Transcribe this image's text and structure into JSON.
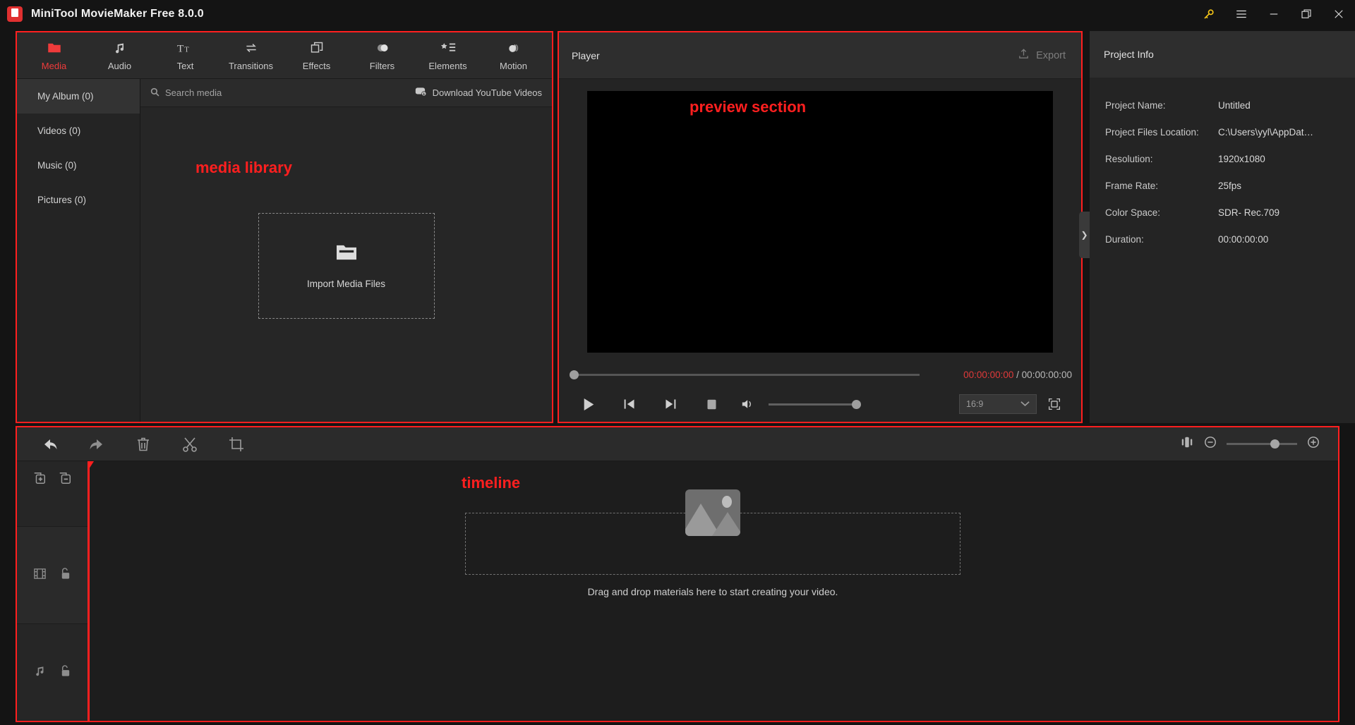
{
  "titlebar": {
    "app_title": "MiniTool MovieMaker Free 8.0.0",
    "logo_name": "minitool-logo",
    "buttons": [
      {
        "name": "key-icon",
        "label": "Activate",
        "color": "#f5c518"
      },
      {
        "name": "menu-icon",
        "label": "Menu"
      },
      {
        "name": "minimize-icon",
        "label": "Minimize"
      },
      {
        "name": "maximize-icon",
        "label": "Maximize"
      },
      {
        "name": "close-icon",
        "label": "Close"
      }
    ]
  },
  "nav_tabs": [
    {
      "label": "Media",
      "icon": "folder-icon",
      "active": true
    },
    {
      "label": "Audio",
      "icon": "music-note-icon",
      "active": false
    },
    {
      "label": "Text",
      "icon": "text-tt-icon",
      "active": false
    },
    {
      "label": "Transitions",
      "icon": "transitions-arrows-icon",
      "active": false
    },
    {
      "label": "Effects",
      "icon": "effects-squares-icon",
      "active": false
    },
    {
      "label": "Filters",
      "icon": "filters-circles-icon",
      "active": false
    },
    {
      "label": "Elements",
      "icon": "elements-star-list-icon",
      "active": false
    },
    {
      "label": "Motion",
      "icon": "motion-sphere-icon",
      "active": false
    }
  ],
  "library": {
    "categories": [
      {
        "label": "My Album (0)",
        "active": true
      },
      {
        "label": "Videos (0)",
        "active": false
      },
      {
        "label": "Music (0)",
        "active": false
      },
      {
        "label": "Pictures (0)",
        "active": false
      }
    ],
    "search_placeholder": "Search media",
    "download_youtube_label": "Download YouTube Videos",
    "import_label": "Import Media Files",
    "annotation": "media library"
  },
  "player": {
    "title": "Player",
    "export_label": "Export",
    "annotation": "preview section",
    "current_time": "00:00:00:00",
    "separator": " / ",
    "total_time": "00:00:00:00",
    "aspect_ratio": "16:9",
    "controls": [
      {
        "name": "play-button",
        "label": "Play"
      },
      {
        "name": "previous-frame-button",
        "label": "Previous frame"
      },
      {
        "name": "next-frame-button",
        "label": "Next frame"
      },
      {
        "name": "stop-button",
        "label": "Stop"
      },
      {
        "name": "volume-icon",
        "label": "Volume"
      }
    ],
    "fullscreen_label": "Fullscreen"
  },
  "project_info": {
    "title": "Project Info",
    "rows": [
      {
        "key": "Project Name:",
        "value": "Untitled"
      },
      {
        "key": "Project Files Location:",
        "value": "C:\\Users\\yyl\\AppDat…"
      },
      {
        "key": "Resolution:",
        "value": "1920x1080"
      },
      {
        "key": "Frame Rate:",
        "value": "25fps"
      },
      {
        "key": "Color Space:",
        "value": "SDR- Rec.709"
      },
      {
        "key": "Duration:",
        "value": "00:00:00:00"
      }
    ],
    "collapse_glyph": "❯"
  },
  "timeline": {
    "annotation": "timeline",
    "tools": [
      {
        "name": "undo-button",
        "label": "Undo"
      },
      {
        "name": "redo-button",
        "label": "Redo"
      },
      {
        "name": "delete-button",
        "label": "Delete"
      },
      {
        "name": "split-button",
        "label": "Split"
      },
      {
        "name": "crop-button",
        "label": "Crop"
      }
    ],
    "zoom": {
      "fit-icon": "fit-to-window-icon",
      "minus_label": "Zoom out",
      "plus_label": "Zoom in"
    },
    "track_headers": [
      {
        "name": "add-track-row",
        "icons": [
          "add-track-icon",
          "remove-track-icon"
        ]
      },
      {
        "name": "video-track-row",
        "icons": [
          "film-strip-icon",
          "unlock-icon"
        ]
      },
      {
        "name": "audio-track-row",
        "icons": [
          "music-note-icon",
          "unlock-icon"
        ]
      }
    ],
    "drop_text": "Drag and drop materials here to start creating your video.",
    "placeholder_icon": "image-placeholder-icon"
  },
  "colors": {
    "accent_red": "#ff1f1f",
    "active_tab": "#ef3b3b",
    "time_current": "#e03a3a",
    "key_yellow": "#f5c518"
  }
}
